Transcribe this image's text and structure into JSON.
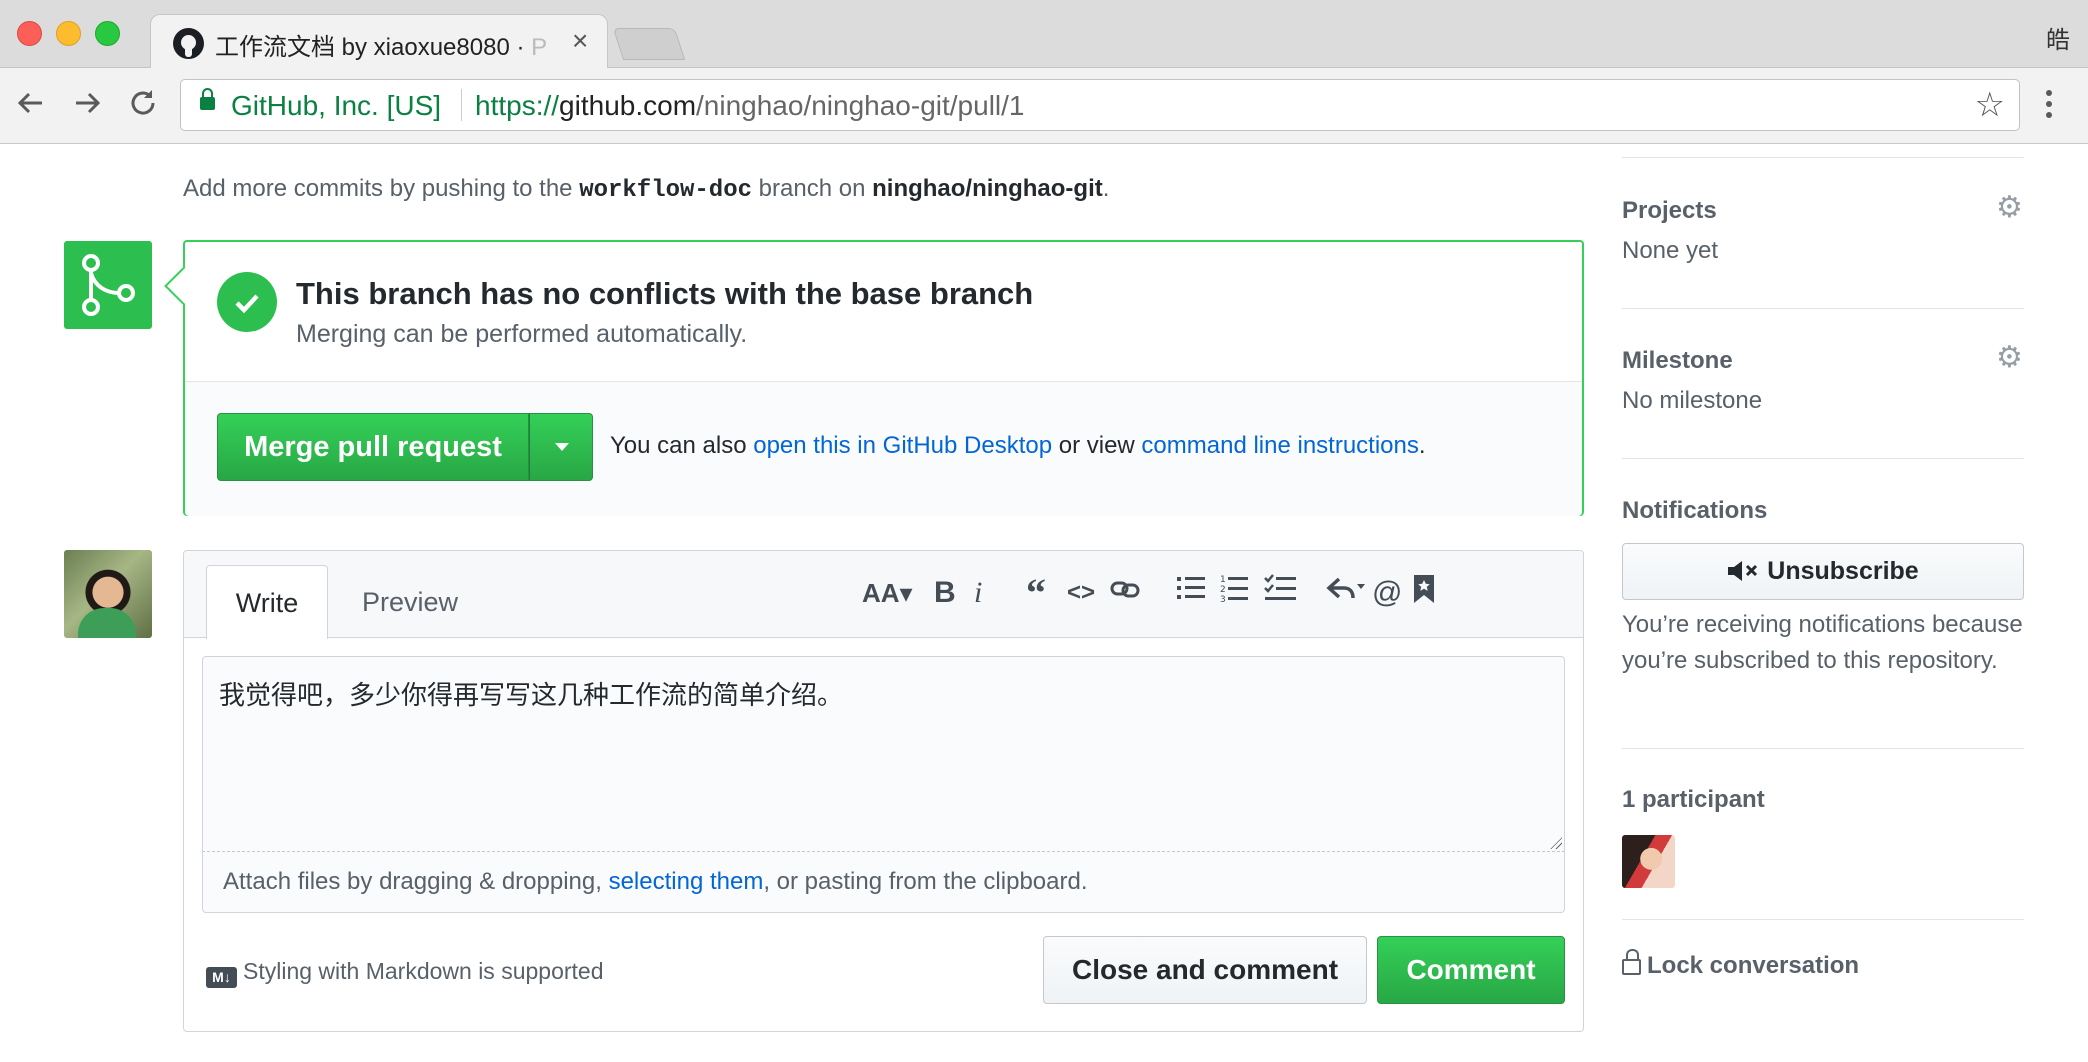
{
  "browser": {
    "tab_title": "工作流文档 by xiaoxue8080 · ",
    "tab_title_faded": "P",
    "close_glyph": "×",
    "profile_char": "皓",
    "ev_name": "GitHub, Inc. [US]",
    "url_scheme": "https://",
    "url_host": "github.com",
    "url_path": "/ninghao/ninghao-git/pull/1"
  },
  "merge": {
    "hint_prefix": "Add more commits by pushing to the ",
    "hint_branch": "workflow-doc",
    "hint_mid": " branch on ",
    "hint_repo": "ninghao/ninghao-git",
    "hint_suffix": ".",
    "title": "This branch has no conflicts with the base branch",
    "subtitle": "Merging can be performed automatically.",
    "merge_button": "Merge pull request",
    "also_prefix": "You can also ",
    "desktop_link": "open this in GitHub Desktop",
    "also_mid": " or view ",
    "cli_link": "command line instructions",
    "also_suffix": "."
  },
  "comment": {
    "tab_write": "Write",
    "tab_preview": "Preview",
    "body": "我觉得吧，多少你得再写写这几种工作流的简单介绍。",
    "attach_prefix": "Attach files by dragging & dropping, ",
    "attach_link": "selecting them",
    "attach_suffix": ", or pasting from the clipboard.",
    "markdown_note": "Styling with Markdown is supported",
    "markdown_badge": "M↓",
    "close_button": "Close and comment",
    "comment_button": "Comment"
  },
  "sidebar": {
    "projects_heading": "Projects",
    "projects_value": "None yet",
    "milestone_heading": "Milestone",
    "milestone_value": "No milestone",
    "notifications_heading": "Notifications",
    "unsubscribe_button": "Unsubscribe",
    "notifications_text": "You’re receiving notifications because you’re subscribed to this repository.",
    "participants_heading": "1 participant",
    "lock_label": "Lock conversation"
  },
  "colors": {
    "accent_green": "#2cbe4e",
    "link_blue": "#0366d6",
    "secure_green": "#0b8043"
  },
  "icons": [
    "github-favicon",
    "back-arrow-icon",
    "forward-arrow-icon",
    "reload-icon",
    "secure-lock-icon",
    "bookmark-star-icon",
    "git-merge-icon",
    "check-icon",
    "gear-icon",
    "mute-icon",
    "padlock-icon",
    "markdown-icon"
  ]
}
